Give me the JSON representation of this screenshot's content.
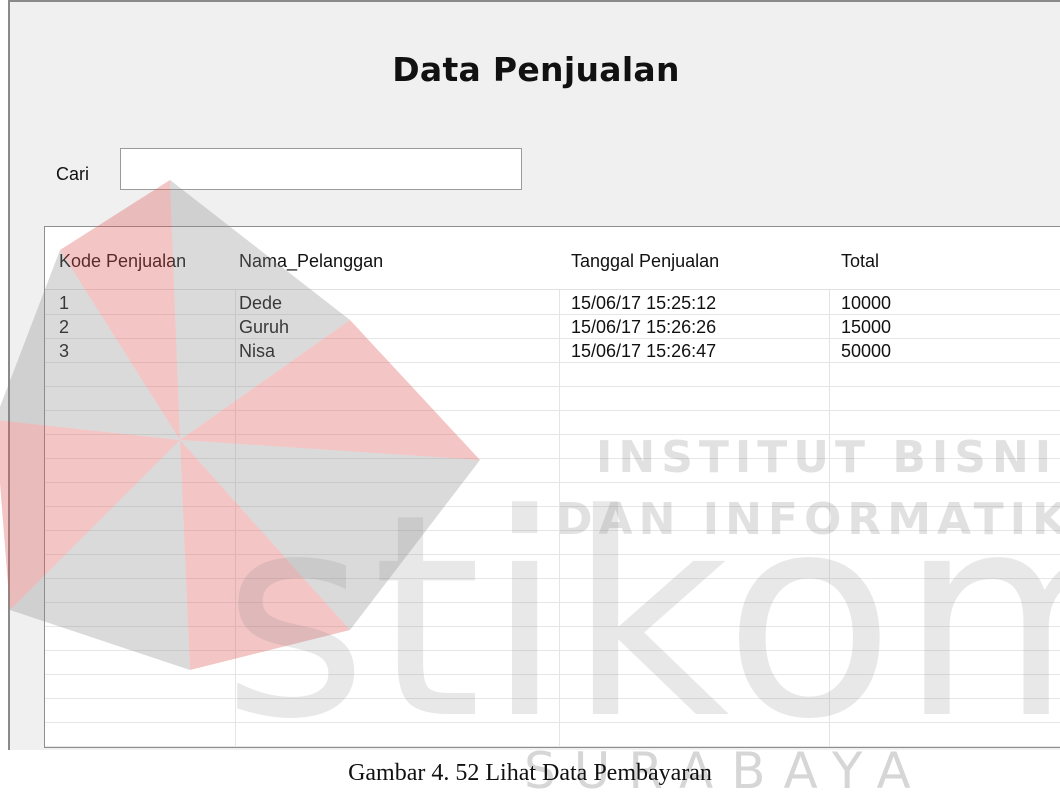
{
  "form": {
    "title": "Data Penjualan",
    "search_label": "Cari",
    "search_value": ""
  },
  "table": {
    "headers": [
      "Kode Penjualan",
      "Nama_Pelanggan",
      "Tanggal Penjualan",
      "Total"
    ],
    "rows": [
      [
        "1",
        "Dede",
        "15/06/17 15:25:12",
        "10000"
      ],
      [
        "2",
        "Guruh",
        "15/06/17 15:26:26",
        "15000"
      ],
      [
        "3",
        "Nisa",
        "15/06/17 15:26:47",
        "50000"
      ]
    ]
  },
  "watermark": {
    "line1": "INSTITUT BISNIS",
    "line2": "DAN INFORMATIKA",
    "brand": "stikom",
    "city": "SURABAYA",
    "colors": {
      "red": "#e05a5a",
      "gray": "#8c8c8c"
    }
  },
  "caption": "Gambar 4. 52 Lihat Data Pembayaran"
}
